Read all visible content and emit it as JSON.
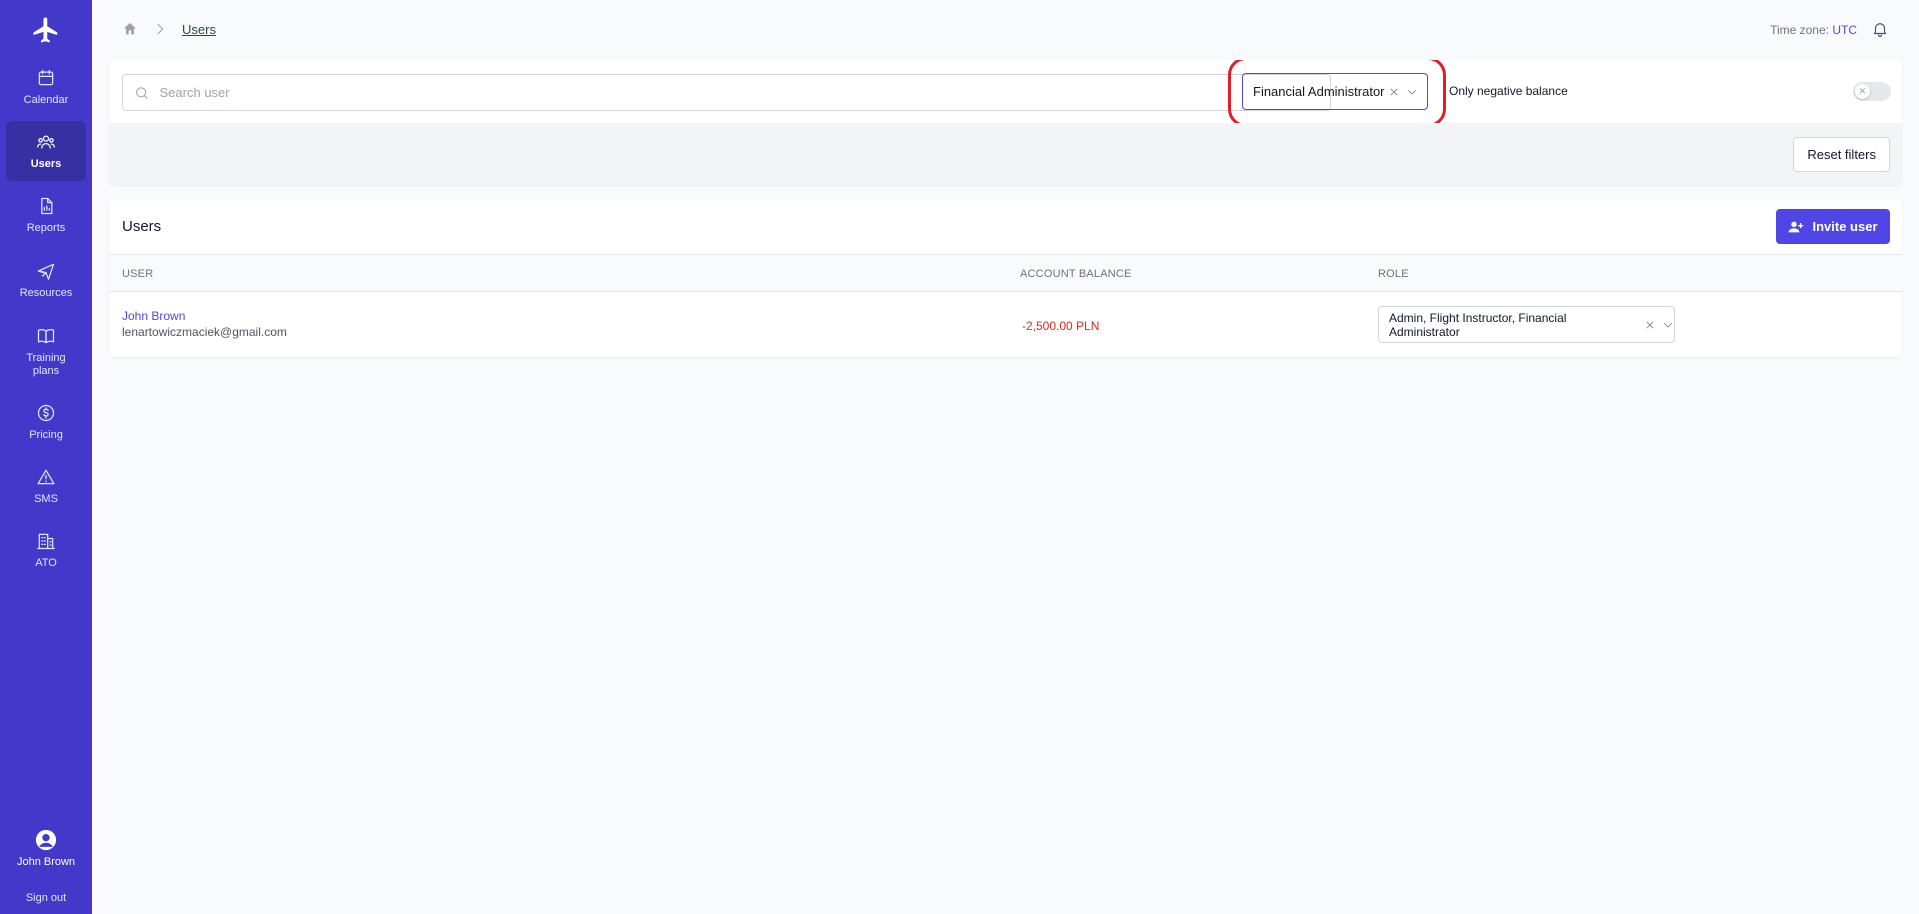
{
  "sidebar": {
    "logo_icon": "airplane-icon",
    "items": [
      {
        "label": "Calendar",
        "icon": "calendar-icon"
      },
      {
        "label": "Users",
        "icon": "users-icon",
        "active": true
      },
      {
        "label": "Reports",
        "icon": "report-icon"
      },
      {
        "label": "Resources",
        "icon": "plane-icon"
      },
      {
        "label": "Training plans",
        "icon": "book-icon"
      },
      {
        "label": "Pricing",
        "icon": "dollar-icon"
      },
      {
        "label": "SMS",
        "icon": "warning-icon"
      },
      {
        "label": "ATO",
        "icon": "building-icon"
      }
    ],
    "profile_name": "John Brown",
    "sign_out": "Sign out"
  },
  "header": {
    "breadcrumb": [
      "Users"
    ],
    "timezone_label": "Time zone:",
    "timezone_value": "UTC"
  },
  "filters": {
    "search_placeholder": "Search user",
    "role_value": "Financial Administrator",
    "negative_balance_label": "Only negative balance",
    "negative_balance_on": false,
    "reset_label": "Reset filters"
  },
  "users": {
    "title": "Users",
    "invite_label": "Invite user",
    "columns": [
      "USER",
      "ACCOUNT BALANCE",
      "ROLE"
    ],
    "rows": [
      {
        "name": "John Brown",
        "email": "lenartowiczmaciek@gmail.com",
        "balance": "-2,500.00 PLN",
        "roles": "Admin, Flight Instructor, Financial Administrator"
      }
    ]
  },
  "colors": {
    "sidebar": "#4338ca",
    "accent": "#4f46e5",
    "negative": "#dc2626",
    "highlight": "#e11d2a"
  }
}
